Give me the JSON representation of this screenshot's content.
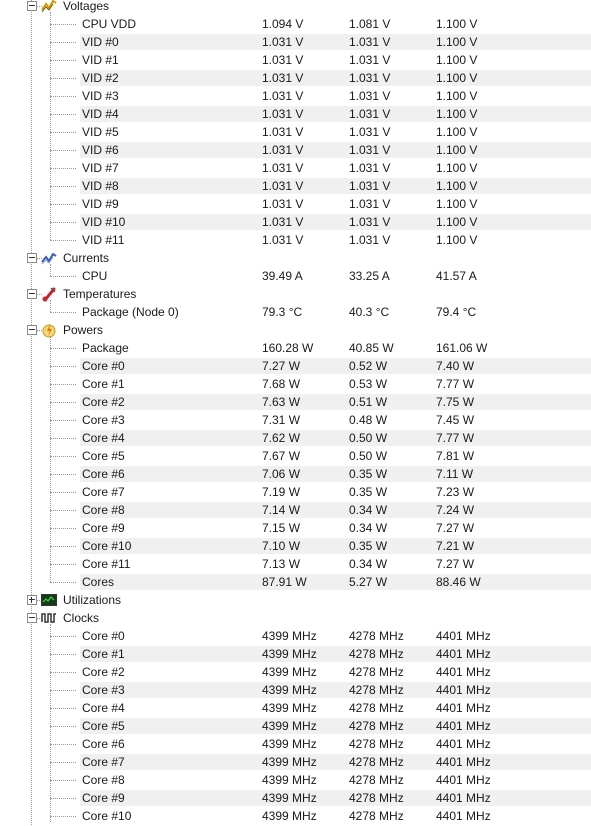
{
  "groups": [
    {
      "label": "Voltages",
      "icon": "voltage-icon",
      "expanded": true,
      "sensors": [
        {
          "name": "CPU VDD",
          "current": "1.094 V",
          "min": "1.081 V",
          "max": "1.100 V"
        },
        {
          "name": "VID #0",
          "current": "1.031 V",
          "min": "1.031 V",
          "max": "1.100 V"
        },
        {
          "name": "VID #1",
          "current": "1.031 V",
          "min": "1.031 V",
          "max": "1.100 V"
        },
        {
          "name": "VID #2",
          "current": "1.031 V",
          "min": "1.031 V",
          "max": "1.100 V"
        },
        {
          "name": "VID #3",
          "current": "1.031 V",
          "min": "1.031 V",
          "max": "1.100 V"
        },
        {
          "name": "VID #4",
          "current": "1.031 V",
          "min": "1.031 V",
          "max": "1.100 V"
        },
        {
          "name": "VID #5",
          "current": "1.031 V",
          "min": "1.031 V",
          "max": "1.100 V"
        },
        {
          "name": "VID #6",
          "current": "1.031 V",
          "min": "1.031 V",
          "max": "1.100 V"
        },
        {
          "name": "VID #7",
          "current": "1.031 V",
          "min": "1.031 V",
          "max": "1.100 V"
        },
        {
          "name": "VID #8",
          "current": "1.031 V",
          "min": "1.031 V",
          "max": "1.100 V"
        },
        {
          "name": "VID #9",
          "current": "1.031 V",
          "min": "1.031 V",
          "max": "1.100 V"
        },
        {
          "name": "VID #10",
          "current": "1.031 V",
          "min": "1.031 V",
          "max": "1.100 V"
        },
        {
          "name": "VID #11",
          "current": "1.031 V",
          "min": "1.031 V",
          "max": "1.100 V"
        }
      ]
    },
    {
      "label": "Currents",
      "icon": "current-icon",
      "expanded": true,
      "sensors": [
        {
          "name": "CPU",
          "current": "39.49 A",
          "min": "33.25 A",
          "max": "41.57 A"
        }
      ]
    },
    {
      "label": "Temperatures",
      "icon": "thermometer-icon",
      "expanded": true,
      "sensors": [
        {
          "name": "Package (Node 0)",
          "current": "79.3 °C",
          "min": "40.3 °C",
          "max": "79.4 °C"
        }
      ]
    },
    {
      "label": "Powers",
      "icon": "power-icon",
      "expanded": true,
      "sensors": [
        {
          "name": "Package",
          "current": "160.28 W",
          "min": "40.85 W",
          "max": "161.06 W"
        },
        {
          "name": "Core #0",
          "current": "7.27 W",
          "min": "0.52 W",
          "max": "7.40 W"
        },
        {
          "name": "Core #1",
          "current": "7.68 W",
          "min": "0.53 W",
          "max": "7.77 W"
        },
        {
          "name": "Core #2",
          "current": "7.63 W",
          "min": "0.51 W",
          "max": "7.75 W"
        },
        {
          "name": "Core #3",
          "current": "7.31 W",
          "min": "0.48 W",
          "max": "7.45 W"
        },
        {
          "name": "Core #4",
          "current": "7.62 W",
          "min": "0.50 W",
          "max": "7.77 W"
        },
        {
          "name": "Core #5",
          "current": "7.67 W",
          "min": "0.50 W",
          "max": "7.81 W"
        },
        {
          "name": "Core #6",
          "current": "7.06 W",
          "min": "0.35 W",
          "max": "7.11 W"
        },
        {
          "name": "Core #7",
          "current": "7.19 W",
          "min": "0.35 W",
          "max": "7.23 W"
        },
        {
          "name": "Core #8",
          "current": "7.14 W",
          "min": "0.34 W",
          "max": "7.24 W"
        },
        {
          "name": "Core #9",
          "current": "7.15 W",
          "min": "0.34 W",
          "max": "7.27 W"
        },
        {
          "name": "Core #10",
          "current": "7.10 W",
          "min": "0.35 W",
          "max": "7.21 W"
        },
        {
          "name": "Core #11",
          "current": "7.13 W",
          "min": "0.34 W",
          "max": "7.27 W"
        },
        {
          "name": "Cores",
          "current": "87.91 W",
          "min": "5.27 W",
          "max": "88.46 W"
        }
      ]
    },
    {
      "label": "Utilizations",
      "icon": "utilization-graph-icon",
      "expanded": false,
      "sensors": []
    },
    {
      "label": "Clocks",
      "icon": "clock-waveform-icon",
      "expanded": true,
      "sensors": [
        {
          "name": "Core #0",
          "current": "4399 MHz",
          "min": "4278 MHz",
          "max": "4401 MHz"
        },
        {
          "name": "Core #1",
          "current": "4399 MHz",
          "min": "4278 MHz",
          "max": "4401 MHz"
        },
        {
          "name": "Core #2",
          "current": "4399 MHz",
          "min": "4278 MHz",
          "max": "4401 MHz"
        },
        {
          "name": "Core #3",
          "current": "4399 MHz",
          "min": "4278 MHz",
          "max": "4401 MHz"
        },
        {
          "name": "Core #4",
          "current": "4399 MHz",
          "min": "4278 MHz",
          "max": "4401 MHz"
        },
        {
          "name": "Core #5",
          "current": "4399 MHz",
          "min": "4278 MHz",
          "max": "4401 MHz"
        },
        {
          "name": "Core #6",
          "current": "4399 MHz",
          "min": "4278 MHz",
          "max": "4401 MHz"
        },
        {
          "name": "Core #7",
          "current": "4399 MHz",
          "min": "4278 MHz",
          "max": "4401 MHz"
        },
        {
          "name": "Core #8",
          "current": "4399 MHz",
          "min": "4278 MHz",
          "max": "4401 MHz"
        },
        {
          "name": "Core #9",
          "current": "4399 MHz",
          "min": "4278 MHz",
          "max": "4401 MHz"
        },
        {
          "name": "Core #10",
          "current": "4399 MHz",
          "min": "4278 MHz",
          "max": "4401 MHz"
        }
      ]
    }
  ]
}
